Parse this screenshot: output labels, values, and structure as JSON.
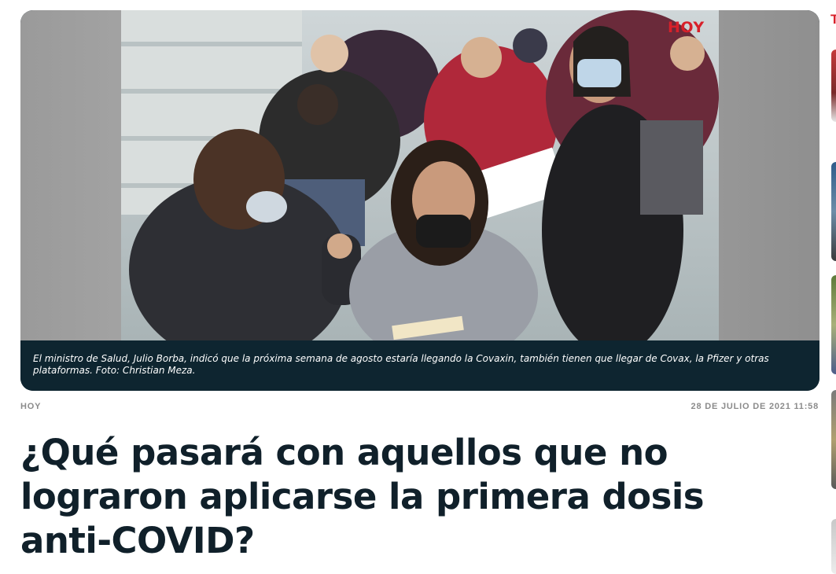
{
  "photo": {
    "logo": "HOY",
    "caption": "El ministro de Salud, Julio Borba, indicó que la próxima semana de agosto estaría llegando la Covaxin, también tienen que llegar de Covax, la Pfizer y otras plataformas. Foto: Christian Meza."
  },
  "article": {
    "section": "HOY",
    "date": "28 DE JULIO DE 2021 11:58",
    "title": "¿Qué pasará con aquellos que no lograron aplicarse la primera dosis anti-COVID?"
  },
  "sidebar": {
    "header_fragment": "T"
  },
  "colors": {
    "brand_red": "#d8202a",
    "caption_bg": "#0e2530",
    "headline": "#10202a",
    "meta_gray": "#8b8b8b"
  }
}
